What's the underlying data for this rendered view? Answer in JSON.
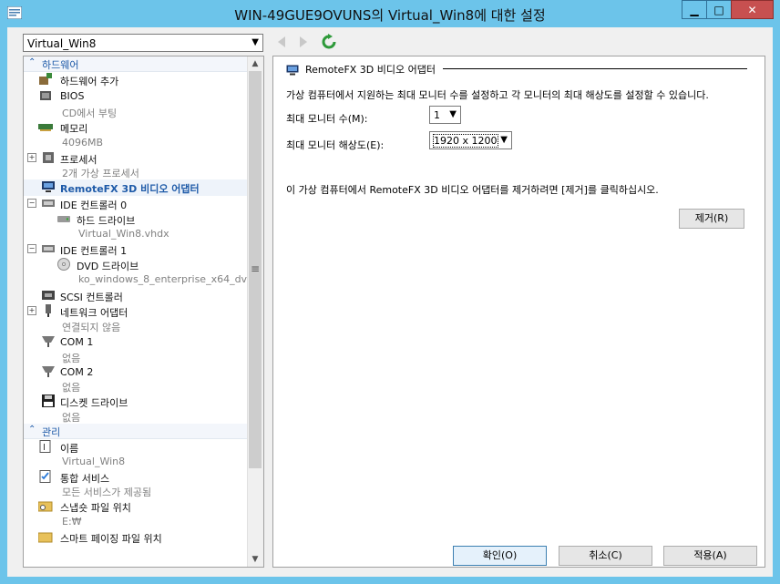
{
  "window": {
    "title": "WIN-49GUE9OVUNS의 Virtual_Win8에 대한 설정",
    "minimize_symbol": "▁",
    "maximize_symbol": "□",
    "close_symbol": "✕"
  },
  "vm_selector": {
    "value": "Virtual_Win8",
    "arrow": "▼"
  },
  "nav": {
    "back_icon": "back-arrow-icon",
    "forward_icon": "forward-arrow-icon",
    "refresh_icon": "refresh-icon"
  },
  "hardware_section": {
    "title": "하드웨어",
    "chevron": "⌃"
  },
  "hardware_items": {
    "add_hardware": "하드웨어 추가",
    "bios": {
      "label": "BIOS",
      "sub": "CD에서 부팅"
    },
    "memory": {
      "label": "메모리",
      "sub": "4096MB"
    },
    "processor": {
      "label": "프로세서",
      "sub": "2개 가상 프로세서"
    },
    "remotefx": {
      "label": "RemoteFX 3D 비디오 어댑터"
    },
    "ide0": {
      "label": "IDE 컨트롤러 0"
    },
    "hard_drive": {
      "label": "하드 드라이브",
      "sub": "Virtual_Win8.vhdx"
    },
    "ide1": {
      "label": "IDE 컨트롤러 1"
    },
    "dvd_drive": {
      "label": "DVD 드라이브",
      "sub": "ko_windows_8_enterprise_x64_dv..."
    },
    "scsi": {
      "label": "SCSI 컨트롤러"
    },
    "network": {
      "label": "네트워크 어댑터",
      "sub": "연결되지 않음"
    },
    "com1": {
      "label": "COM 1",
      "sub": "없음"
    },
    "com2": {
      "label": "COM 2",
      "sub": "없음"
    },
    "diskette": {
      "label": "디스켓 드라이브",
      "sub": "없음"
    }
  },
  "management_section": {
    "title": "관리",
    "chevron": "⌃"
  },
  "management_items": {
    "name": {
      "label": "이름",
      "sub": "Virtual_Win8"
    },
    "integration": {
      "label": "통합 서비스",
      "sub": "모든 서비스가 제공됨"
    },
    "snapshot": {
      "label": "스냅숏 파일 위치",
      "sub": "E:₩"
    },
    "smart_paging": {
      "label": "스마트 페이징 파일 위치"
    }
  },
  "expanders": {
    "plus": "+",
    "minus": "−"
  },
  "scrollbar": {
    "up": "▲",
    "down": "▼",
    "grip": "≡"
  },
  "panel": {
    "title": "RemoteFX 3D 비디오 어댑터",
    "description": "가상 컴퓨터에서 지원하는 최대 모니터 수를 설정하고 각 모니터의 최대 해상도를 설정할 수 있습니다.",
    "max_monitors_label": "최대 모니터 수(M):",
    "max_monitors_value": "1",
    "max_resolution_label": "최대 모니터 해상도(E):",
    "max_resolution_value": "1920 x 1200",
    "remove_note": "이 가상 컴퓨터에서 RemoteFX 3D 비디오 어댑터를 제거하려면 [제거]를 클릭하십시오.",
    "remove_button": "제거(R)",
    "dropdown_arrow": "▼"
  },
  "footer": {
    "ok": "확인(O)",
    "cancel": "취소(C)",
    "apply": "적용(A)"
  },
  "colors": {
    "titlebar": "#6cc4ea",
    "section_text": "#1e5aa8",
    "close": "#c75050"
  }
}
